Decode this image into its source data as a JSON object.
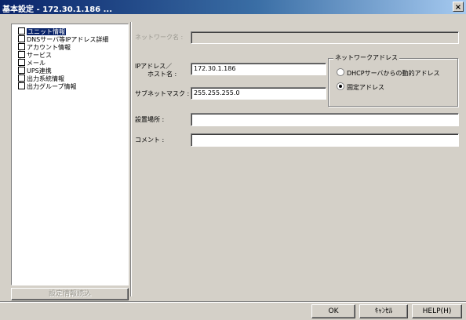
{
  "window": {
    "title": "基本設定 - 172.30.1.186 ...",
    "close_glyph": "×"
  },
  "tree": {
    "items": [
      {
        "label": "ユニット情報",
        "selected": true
      },
      {
        "label": "DNSサーバ等IPアドレス詳細",
        "selected": false
      },
      {
        "label": "アカウント情報",
        "selected": false
      },
      {
        "label": "サービス",
        "selected": false
      },
      {
        "label": "メール",
        "selected": false
      },
      {
        "label": "UPS連携",
        "selected": false
      },
      {
        "label": "出力系統情報",
        "selected": false
      },
      {
        "label": "出力グループ情報",
        "selected": false
      }
    ]
  },
  "load_button": {
    "label": "設定情報読込"
  },
  "form": {
    "network_name": {
      "label": "ネットワーク名 :",
      "value": ""
    },
    "ip_address": {
      "label_line1": "IPアドレス／",
      "label_line2": "ホスト名 :",
      "value": "172.30.1.186"
    },
    "subnet_mask": {
      "label": "サブネットマスク :",
      "value": "255.255.255.0"
    },
    "location": {
      "label": "設置場所 :",
      "value": ""
    },
    "comment": {
      "label": "コメント :",
      "value": ""
    }
  },
  "network_address_group": {
    "title": "ネットワークアドレス",
    "options": [
      {
        "label": "DHCPサーバからの動的アドレス",
        "checked": false
      },
      {
        "label": "固定アドレス",
        "checked": true
      }
    ]
  },
  "footer": {
    "ok_label": "OK",
    "cancel_label": "ｷｬﾝｾﾙ",
    "help_label": "HELP(H)"
  }
}
